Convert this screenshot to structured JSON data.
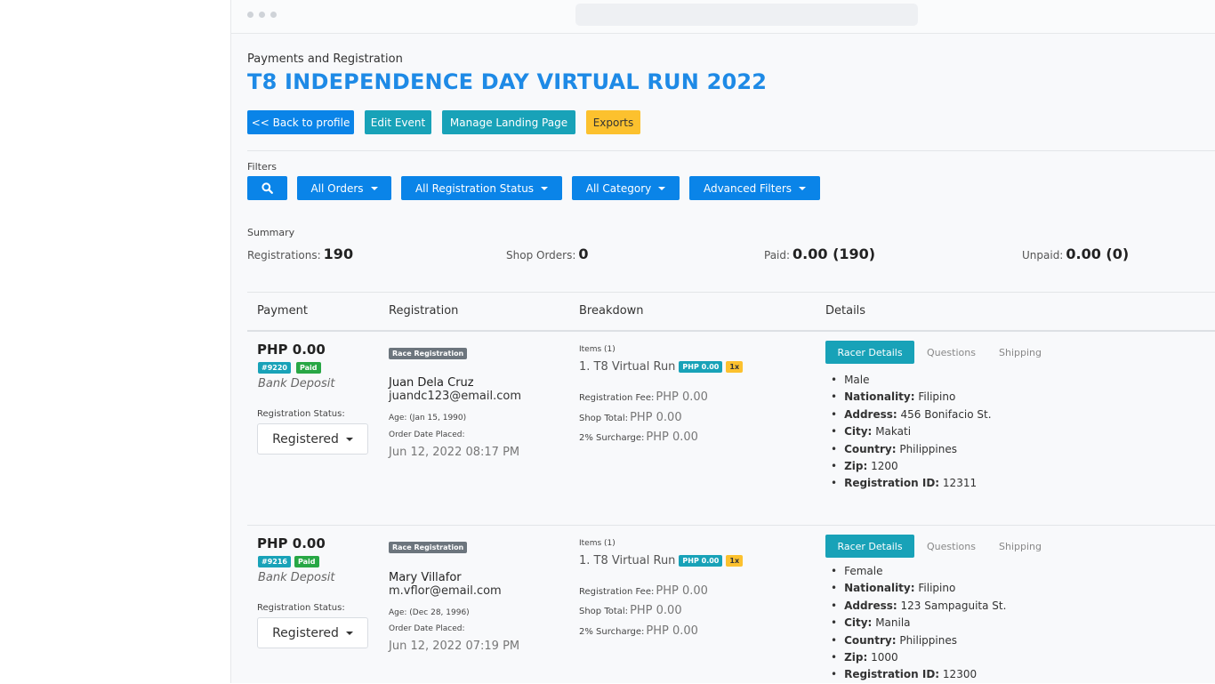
{
  "header": {
    "subtitle": "Payments and Registration",
    "title": "T8 INDEPENDENCE DAY VIRTUAL RUN 2022"
  },
  "actions": {
    "back": "<< Back to profile",
    "edit": "Edit Event",
    "manage": "Manage Landing Page",
    "exports": "Exports"
  },
  "filters": {
    "label": "Filters",
    "orders": "All Orders",
    "registration_status": "All Registration Status",
    "category": "All Category",
    "advanced": "Advanced Filters"
  },
  "summary": {
    "label": "Summary",
    "registrations_label": "Registrations:",
    "registrations_value": "190",
    "shop_orders_label": "Shop Orders:",
    "shop_orders_value": "0",
    "paid_label": "Paid:",
    "paid_value": "0.00 (190)",
    "unpaid_label": "Unpaid:",
    "unpaid_value": "0.00 (0)"
  },
  "table": {
    "columns": [
      "Payment",
      "Registration",
      "Breakdown",
      "Details"
    ]
  },
  "rows": [
    {
      "amount": "PHP 0.00",
      "order_id": "#9220",
      "paid_badge": "Paid",
      "method": "Bank Deposit",
      "status_label": "Registration Status:",
      "status_value": "Registered",
      "reg_badge": "Race Registration",
      "name": "Juan Dela Cruz",
      "email": "juandc123@email.com",
      "age": "Age: (Jan 15, 1990)",
      "order_date_label": "Order Date Placed:",
      "order_date": "Jun 12, 2022 08:17 PM",
      "items_label": "Items (1)",
      "item": "1. T8 Virtual Run",
      "item_price": "PHP 0.00",
      "item_qty": "1x",
      "reg_fee_label": "Registration Fee:",
      "reg_fee": "PHP 0.00",
      "shop_total_label": "Shop Total:",
      "shop_total": "PHP 0.00",
      "surcharge_label": "2% Surcharge:",
      "surcharge": "PHP 0.00",
      "tabs": [
        "Racer Details",
        "Questions",
        "Shipping"
      ],
      "details": [
        {
          "label": "",
          "value": "Male"
        },
        {
          "label": "Nationality:",
          "value": "Filipino"
        },
        {
          "label": "Address:",
          "value": "456 Bonifacio St."
        },
        {
          "label": "City:",
          "value": "Makati"
        },
        {
          "label": "Country:",
          "value": "Philippines"
        },
        {
          "label": "Zip:",
          "value": "1200"
        },
        {
          "label": "Registration ID:",
          "value": "12311"
        }
      ]
    },
    {
      "amount": "PHP 0.00",
      "order_id": "#9216",
      "paid_badge": "Paid",
      "method": "Bank Deposit",
      "status_label": "Registration Status:",
      "status_value": "Registered",
      "reg_badge": "Race Registration",
      "name": "Mary Villafor",
      "email": "m.vflor@email.com",
      "age": "Age: (Dec 28, 1996)",
      "order_date_label": "Order Date Placed:",
      "order_date": "Jun 12, 2022 07:19 PM",
      "items_label": "Items (1)",
      "item": "1. T8 Virtual Run",
      "item_price": "PHP 0.00",
      "item_qty": "1x",
      "reg_fee_label": "Registration Fee:",
      "reg_fee": "PHP 0.00",
      "shop_total_label": "Shop Total:",
      "shop_total": "PHP 0.00",
      "surcharge_label": "2% Surcharge:",
      "surcharge": "PHP 0.00",
      "tabs": [
        "Racer Details",
        "Questions",
        "Shipping"
      ],
      "details": [
        {
          "label": "",
          "value": "Female"
        },
        {
          "label": "Nationality:",
          "value": "Filipino"
        },
        {
          "label": "Address:",
          "value": "123 Sampaguita St."
        },
        {
          "label": "City:",
          "value": "Manila"
        },
        {
          "label": "Country:",
          "value": "Philippines"
        },
        {
          "label": "Zip:",
          "value": "1000"
        },
        {
          "label": "Registration ID:",
          "value": "12300"
        }
      ]
    }
  ],
  "icons": {
    "search": "search-icon",
    "caret": "caret-down-icon"
  },
  "colors": {
    "primary": "#0a84e8",
    "info": "#18a2b8",
    "warning": "#fcc12e",
    "success": "#28a745",
    "title": "#1e8ae6"
  }
}
